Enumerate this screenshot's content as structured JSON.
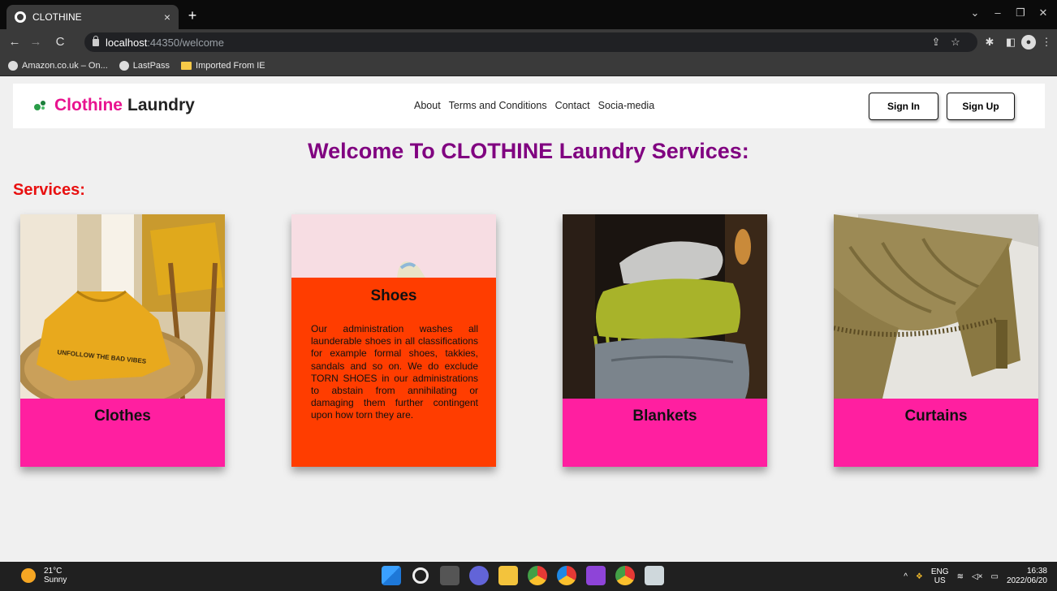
{
  "browser": {
    "tab_title": "CLOTHINE",
    "tab_close": "×",
    "new_tab": "+",
    "url_host": "localhost",
    "url_path": ":44350/welcome",
    "bookmarks": [
      "Amazon.co.uk – On...",
      "LastPass",
      "Imported From IE"
    ]
  },
  "nav": {
    "brand": "Clothine",
    "brand_rest": "Laundry",
    "links": [
      "About",
      "Terms and Conditions",
      "Contact",
      "Socia-media"
    ],
    "sign_in": "Sign In",
    "sign_up": "Sign Up"
  },
  "main": {
    "welcome": "Welcome To CLOTHINE Laundry Services:",
    "services_heading": "Services:",
    "cards": [
      {
        "title": "Clothes"
      },
      {
        "title": "Shoes",
        "description": "Our administration washes all launderable shoes in all classifications for example formal shoes, takkies, sandals and so on. We do exclude TORN SHOES in our administrations to abstain from annihilating or damaging them further contingent upon how torn they are."
      },
      {
        "title": "Blankets"
      },
      {
        "title": "Curtains"
      }
    ],
    "shirt_print": "UNFOLLOW THE BAD VIBES"
  },
  "taskbar": {
    "temp": "21°C",
    "weather": "Sunny",
    "lang_top": "ENG",
    "lang_bottom": "US",
    "time": "16:38",
    "date": "2022/06/20"
  },
  "colors": {
    "brand_pink": "#e8138f",
    "welcome_purple": "#800080",
    "services_red": "#e81010",
    "card_pink": "#ff1fa0",
    "card_orange": "#ff3d00"
  }
}
